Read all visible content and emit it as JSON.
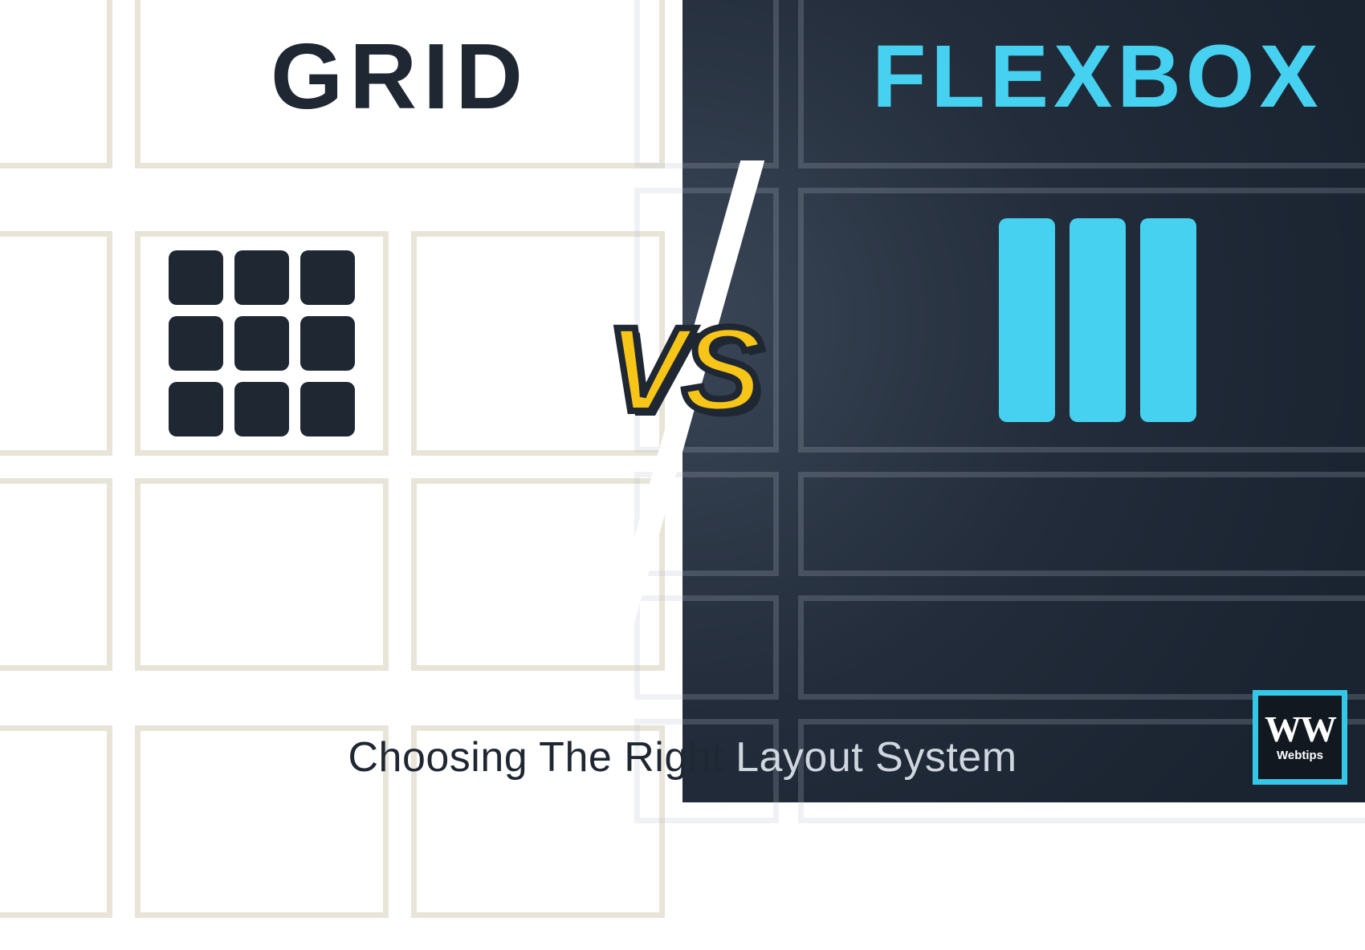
{
  "left": {
    "title": "GRID"
  },
  "right": {
    "title": "FLEXBOX"
  },
  "vs_label": "VS",
  "subtitle_left": "Choosing The Right ",
  "subtitle_right": "Layout System",
  "logo": {
    "mark": "WW",
    "name": "Webtips"
  },
  "colors": {
    "dark": "#1f2733",
    "cyan": "#46d1f0",
    "gold": "#f7c518",
    "cream_border": "#e8e4d8"
  }
}
